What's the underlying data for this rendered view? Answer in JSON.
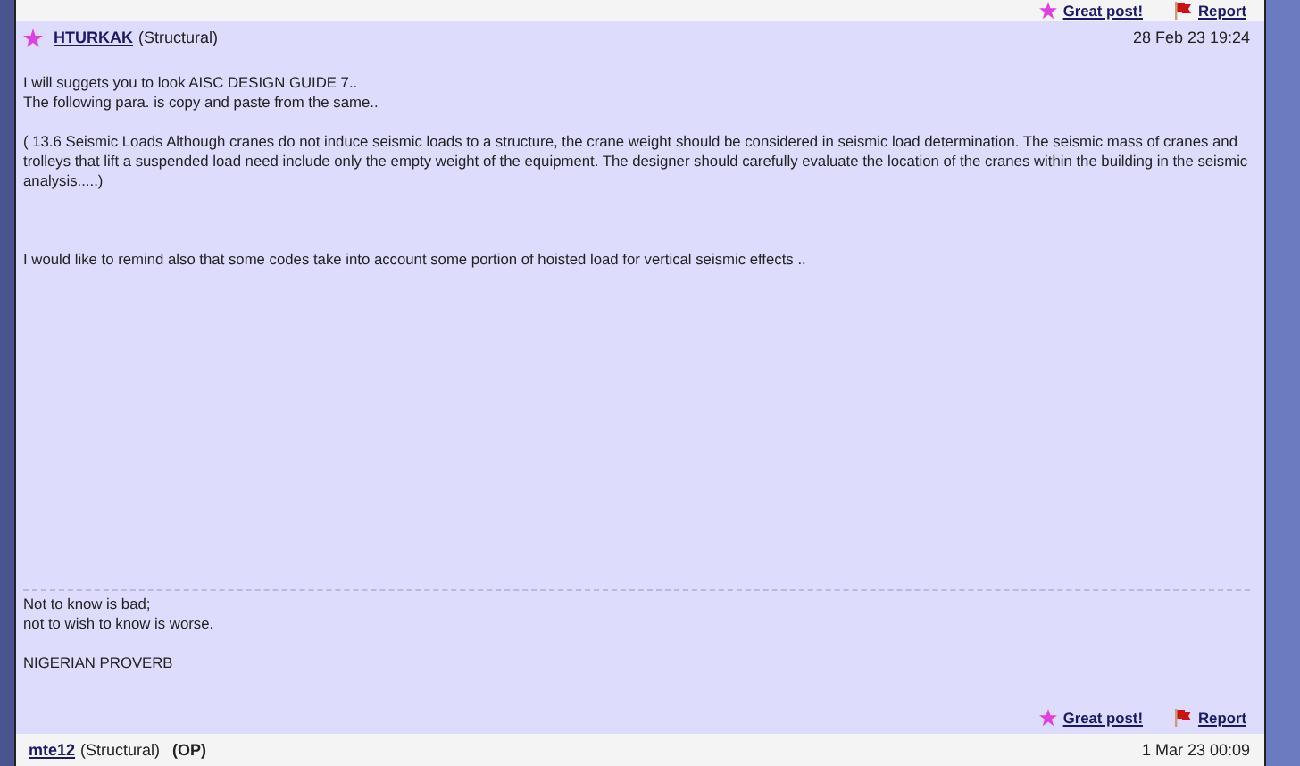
{
  "top_actions": {
    "great_post": "Great post!",
    "report": "Report"
  },
  "posts": [
    {
      "author": "HTURKAK",
      "forum": "(Structural)",
      "starred": true,
      "date": "28 Feb 23 19:24",
      "paragraphs": [
        "I will suggets you to look AISC DESIGN GUIDE 7..\nThe following para. is copy and paste from the same..",
        "( 13.6 Seismic Loads Although cranes do not induce seismic loads to a structure, the crane weight should be considered in seismic load determination. The seismic mass of cranes and trolleys that lift a suspended load need include only the empty weight of the equipment. The designer should carefully evaluate the location of the cranes within the building in the seismic analysis.....)",
        "I would like to remind also that some codes take into account some portion of hoisted load for vertical seismic effects .."
      ],
      "signature": [
        "Not to know is bad;\nnot to wish to know is worse.",
        "NIGERIAN PROVERB"
      ],
      "actions": {
        "great_post": "Great post!",
        "report": "Report"
      }
    },
    {
      "author": "mte12",
      "forum": "(Structural)",
      "op_label": "(OP)",
      "starred": false,
      "date": "1 Mar 23 00:09"
    }
  ]
}
